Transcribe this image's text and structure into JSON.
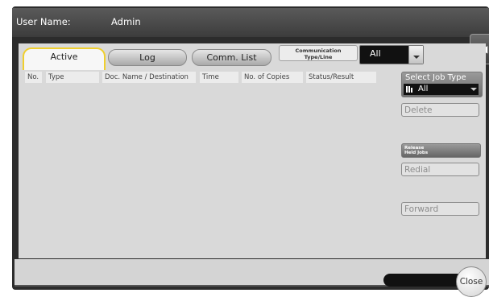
{
  "header": {
    "user_label": "User Name:",
    "user_value": "Admin"
  },
  "side_tab": {
    "icon": "double-chevron-left-icon",
    "glyph": "◀◀"
  },
  "tabs": [
    {
      "label": "Active",
      "active": true
    },
    {
      "label": "Log",
      "active": false
    },
    {
      "label": "Comm. List",
      "active": false
    }
  ],
  "comm_filter": {
    "label_line1": "Communication",
    "label_line2": "Type/Line",
    "value": "All"
  },
  "columns": [
    "No.",
    "Type",
    "Doc. Name / Destination",
    "Time",
    "No. of Copies",
    "Status/Result"
  ],
  "job_type": {
    "label": "Select Job Type",
    "value": "All",
    "icon": "stack-icon"
  },
  "buttons": {
    "delete": "Delete",
    "release_line1": "Release",
    "release_line2": "Held Jobs",
    "redial": "Redial",
    "forward": "Forward",
    "close": "Close"
  },
  "colors": {
    "accent_tab_border": "#f0cf2e",
    "header_bg": "#3c3c3c",
    "panel_bg": "#d9d9d9"
  }
}
